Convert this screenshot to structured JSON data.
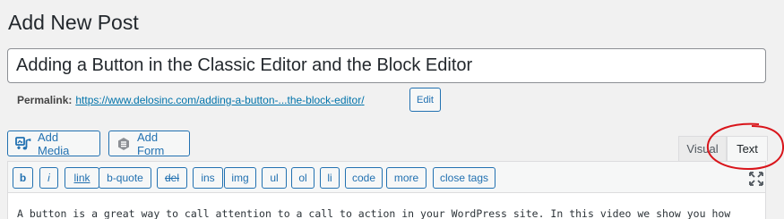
{
  "page": {
    "title": "Add New Post"
  },
  "post": {
    "title": "Adding a Button in the Classic Editor and the Block Editor"
  },
  "permalink": {
    "label": "Permalink:",
    "url_base": "https://www.delosinc.com/",
    "url_slug": "adding-a-button-...the-block-editor",
    "url_tail": "/",
    "edit_label": "Edit"
  },
  "media_buttons": {
    "add_media": {
      "label": "Add Media",
      "icon": "media-icon"
    },
    "add_form": {
      "label": "Add Form",
      "icon": "form-icon"
    }
  },
  "editor_tabs": [
    {
      "label": "Visual",
      "active": false
    },
    {
      "label": "Text",
      "active": true
    }
  ],
  "quicktags": [
    {
      "label": "b"
    },
    {
      "label": "i"
    },
    {
      "label": "link"
    },
    {
      "label": "b-quote"
    },
    {
      "label": "del"
    },
    {
      "label": "ins"
    },
    {
      "label": "img"
    },
    {
      "label": "ul"
    },
    {
      "label": "ol"
    },
    {
      "label": "li"
    },
    {
      "label": "code"
    },
    {
      "label": "more"
    },
    {
      "label": "close tags"
    }
  ],
  "editor": {
    "content": "A button is a great way to call attention to a call to action in your WordPress site. In this video we show you how"
  },
  "colors": {
    "accent": "#2271b1",
    "link": "#0073aa",
    "annotation": "#d9151b"
  }
}
